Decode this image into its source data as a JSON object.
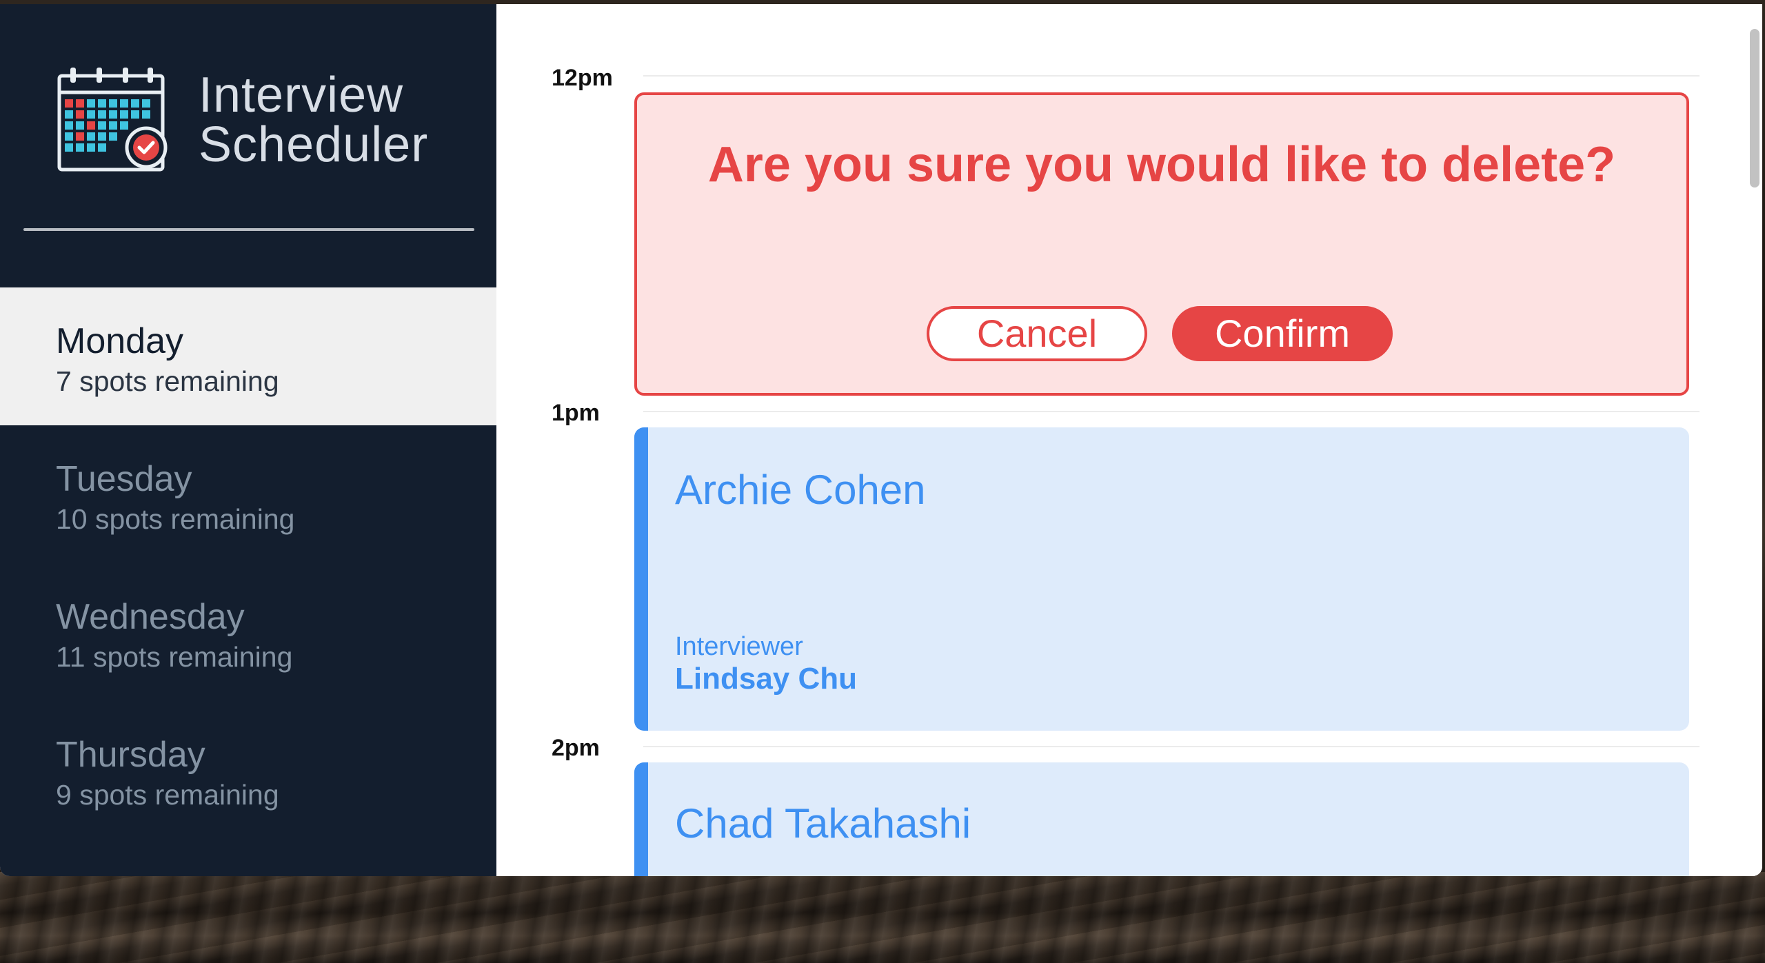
{
  "app": {
    "title_line1": "Interview",
    "title_line2": "Scheduler",
    "logo_icon": "calendar-check-icon"
  },
  "days": [
    {
      "name": "Monday",
      "spots": "7 spots remaining",
      "selected": true
    },
    {
      "name": "Tuesday",
      "spots": "10 spots remaining",
      "selected": false
    },
    {
      "name": "Wednesday",
      "spots": "11 spots remaining",
      "selected": false
    },
    {
      "name": "Thursday",
      "spots": "9 spots remaining",
      "selected": false
    }
  ],
  "schedule": {
    "times": [
      "12pm",
      "1pm",
      "2pm"
    ],
    "confirm": {
      "message": "Are you sure you would like to delete?",
      "cancel_label": "Cancel",
      "confirm_label": "Confirm"
    },
    "appointments": [
      {
        "student": "Archie Cohen",
        "interviewer_label": "Interviewer",
        "interviewer": "Lindsay Chu"
      },
      {
        "student": "Chad Takahashi"
      }
    ]
  },
  "colors": {
    "sidebar_bg": "#131e2e",
    "danger": "#e64545",
    "danger_bg": "#fde2e2",
    "appointment_accent": "#3e90f2",
    "appointment_bg": "#deebfb"
  }
}
